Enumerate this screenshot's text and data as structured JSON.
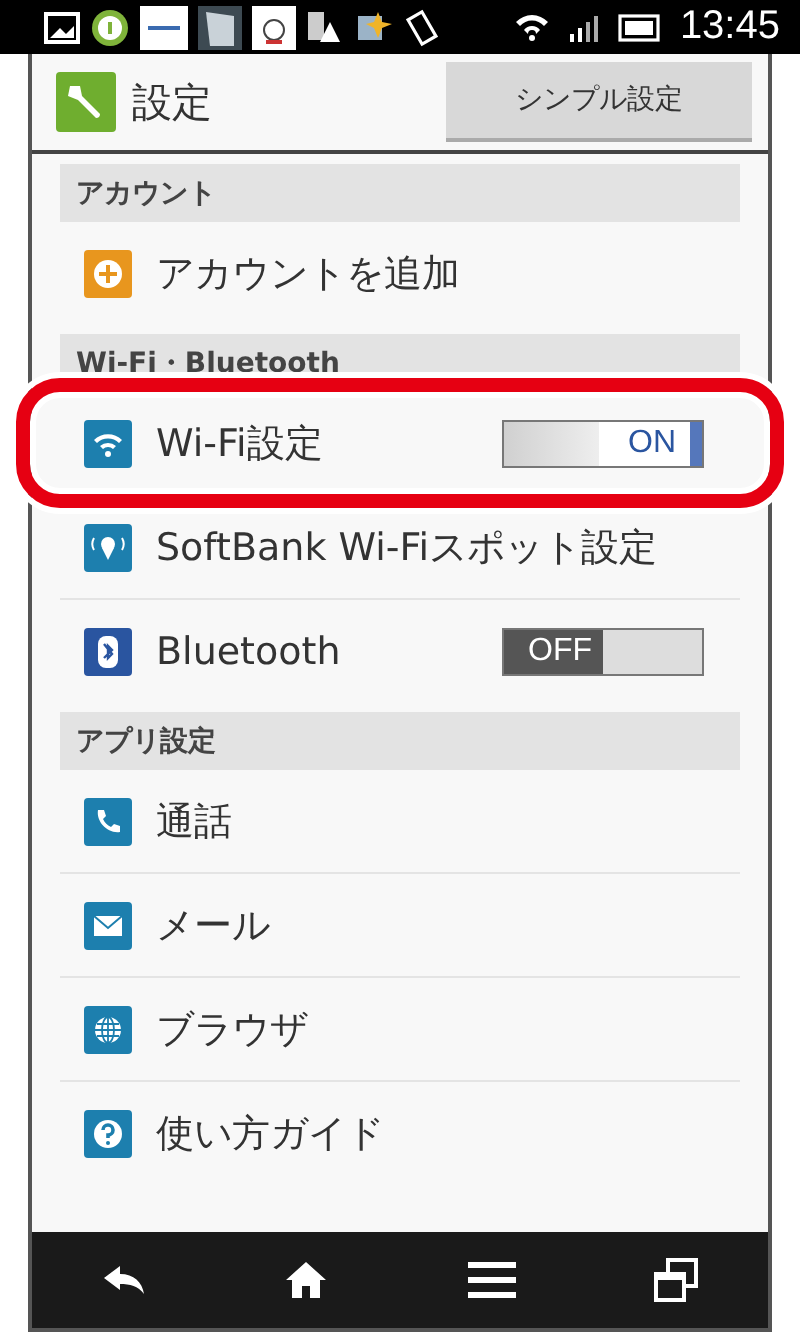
{
  "status_bar": {
    "time": "13:45"
  },
  "header": {
    "title": "設定",
    "button": "シンプル設定"
  },
  "sections": [
    {
      "header": "アカウント",
      "items": [
        {
          "label": "アカウントを追加",
          "kind": "plain",
          "highlighted": false
        }
      ]
    },
    {
      "header": "Wi-Fi・Bluetooth",
      "items": [
        {
          "label": "Wi-Fi設定",
          "kind": "toggle",
          "on": true,
          "toggle_label": "ON",
          "highlighted": true
        },
        {
          "label": "SoftBank Wi-Fiスポット設定",
          "kind": "plain",
          "highlighted": false
        },
        {
          "label": "Bluetooth",
          "kind": "toggle",
          "on": false,
          "toggle_label": "OFF",
          "highlighted": false
        }
      ]
    },
    {
      "header": "アプリ設定",
      "items": [
        {
          "label": "通話",
          "kind": "plain",
          "highlighted": false
        },
        {
          "label": "メール",
          "kind": "plain",
          "highlighted": false
        },
        {
          "label": "ブラウザ",
          "kind": "plain",
          "highlighted": false
        },
        {
          "label": "使い方ガイド",
          "kind": "plain",
          "highlighted": false
        }
      ]
    }
  ]
}
